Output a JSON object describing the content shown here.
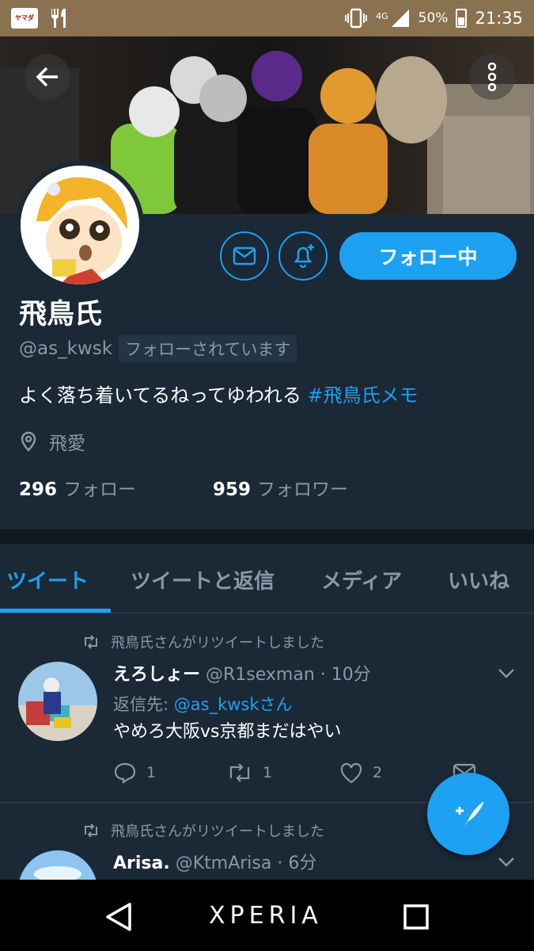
{
  "status_bar": {
    "network": "4G",
    "battery": "50%",
    "time": "21:35",
    "app_badge": "ヤマダ"
  },
  "profile": {
    "name": "飛鳥氏",
    "handle": "@as_kwsk",
    "follows_you": "フォローされています",
    "bio_text": "よく落ち着いてるねってゆわれる ",
    "bio_hashtag": "#飛鳥氏メモ",
    "location": "飛愛",
    "following_count": "296",
    "following_label": "フォロー",
    "followers_count": "959",
    "followers_label": "フォロワー",
    "follow_button": "フォロー中"
  },
  "tabs": [
    {
      "label": "ツイート",
      "active": true
    },
    {
      "label": "ツイートと返信"
    },
    {
      "label": "メディア"
    },
    {
      "label": "いいね"
    }
  ],
  "tweets": [
    {
      "retweeted_by": "飛鳥氏さんがリツイートしました",
      "author": "えろしょー",
      "meta": "@R1sexman · 10分",
      "reply_prefix": "返信先: ",
      "reply_to": "@as_kwskさん",
      "text": "やめろ大阪vs京都まだはやい",
      "replies": "1",
      "retweets": "1",
      "likes": "2"
    },
    {
      "retweeted_by": "飛鳥氏さんがリツイートしました",
      "author": "Arisa.",
      "meta": "@KtmArisa · 6分"
    }
  ],
  "nav": {
    "brand": "XPERIA"
  },
  "colors": {
    "accent": "#1da1f2",
    "background": "#1b2836",
    "muted": "#8899a6",
    "status_bar": "#8a7150"
  }
}
